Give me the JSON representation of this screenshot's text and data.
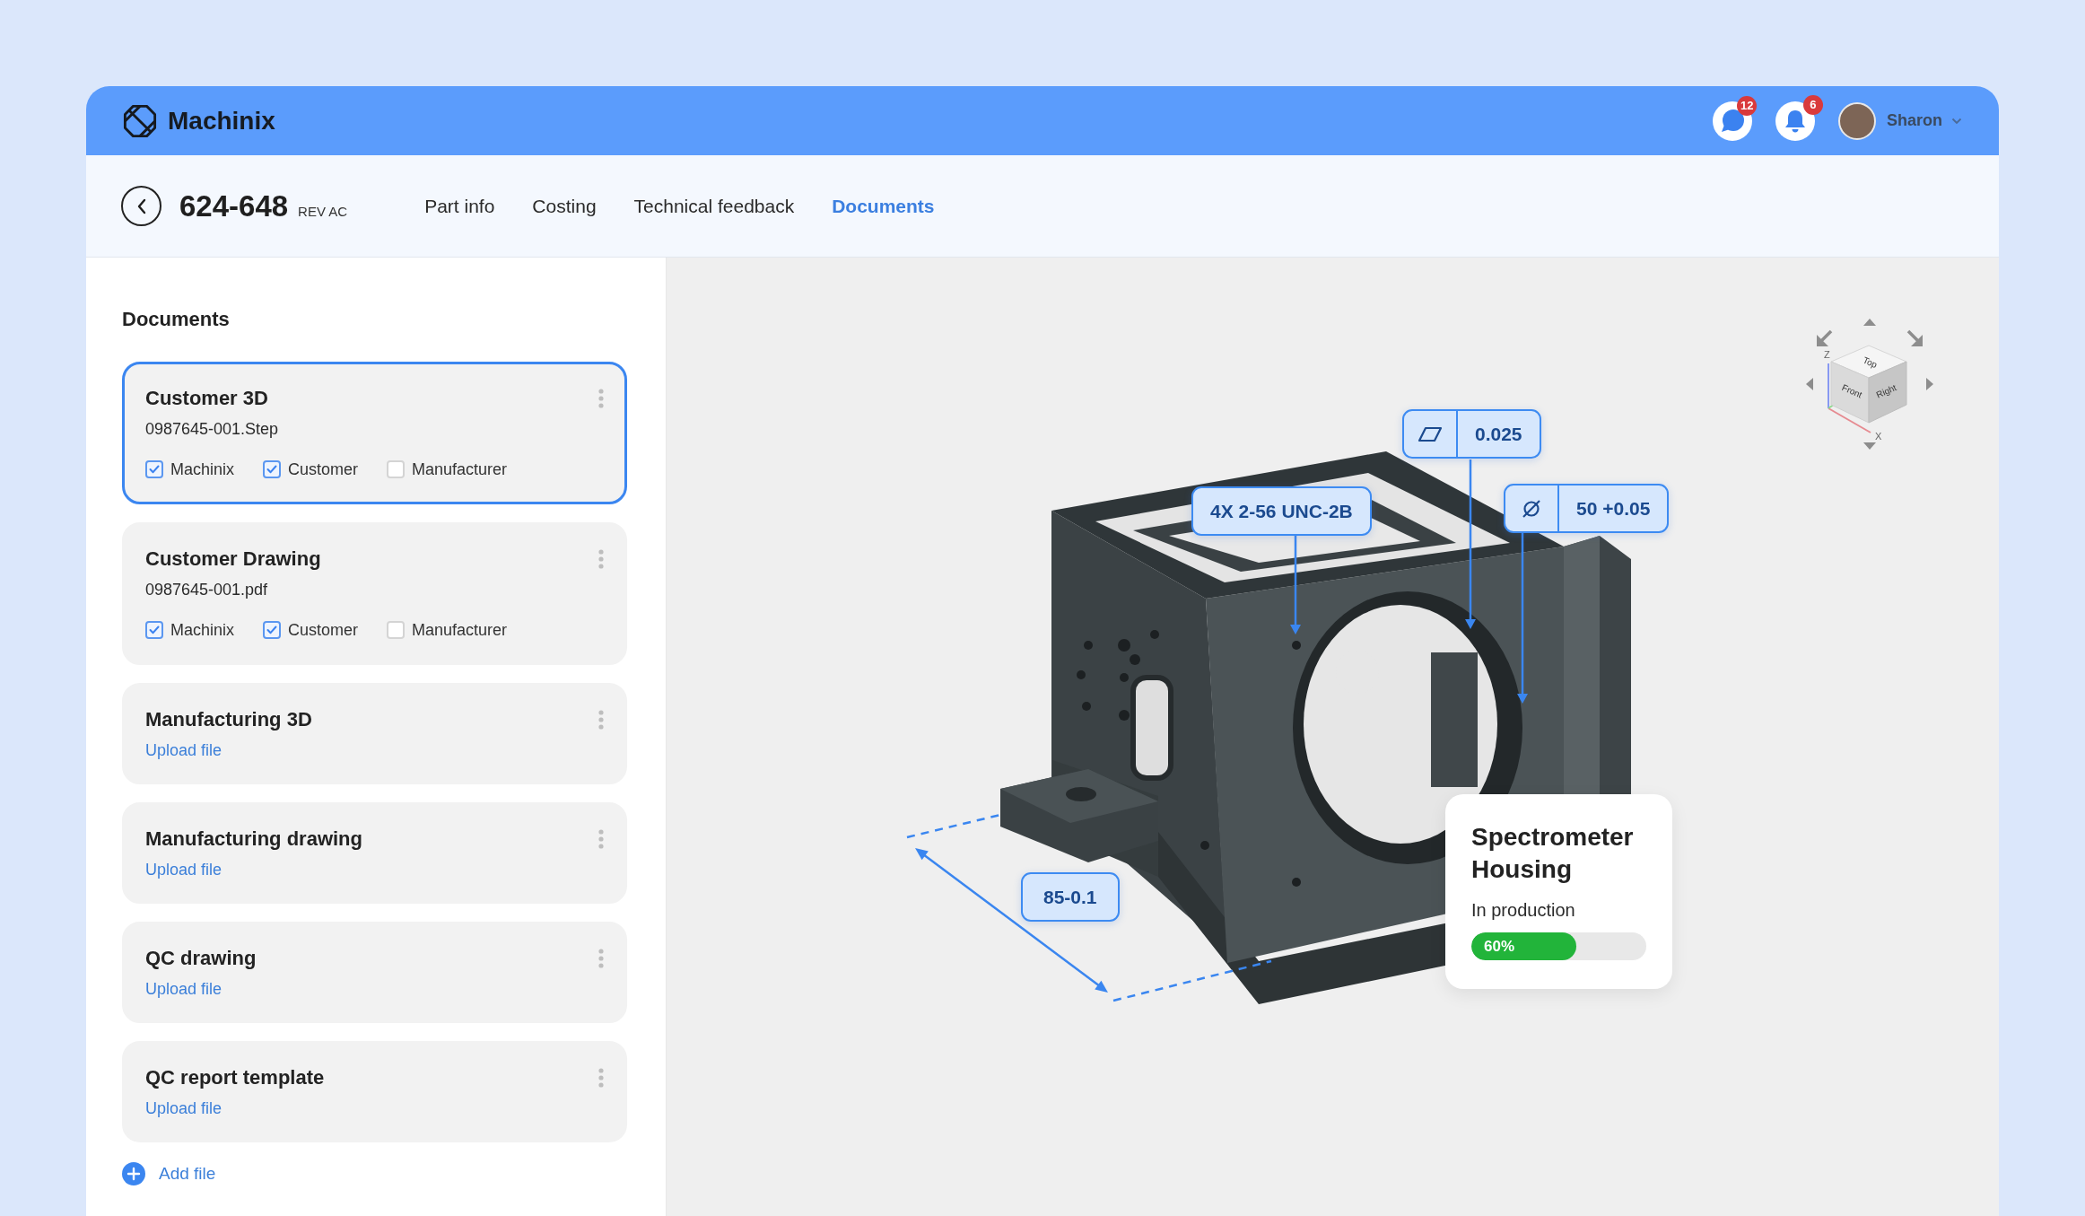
{
  "app": {
    "name": "Machinix"
  },
  "header": {
    "notifications": [
      {
        "kind": "chat",
        "count": "12"
      },
      {
        "kind": "bell",
        "count": "6"
      }
    ],
    "user": {
      "name": "Sharon"
    }
  },
  "part": {
    "number": "624-648",
    "revision": "REV AC"
  },
  "tabs": [
    {
      "label": "Part info",
      "selected": false
    },
    {
      "label": "Costing",
      "selected": false
    },
    {
      "label": "Technical feedback",
      "selected": false
    },
    {
      "label": "Documents",
      "selected": true
    }
  ],
  "documents": {
    "title": "Documents",
    "items": [
      {
        "kind": "file",
        "title": "Customer 3D",
        "selected": true,
        "file": "0987645-001.Step",
        "access": [
          {
            "label": "Machinix",
            "checked": true
          },
          {
            "label": "Customer",
            "checked": true
          },
          {
            "label": "Manufacturer",
            "checked": false
          }
        ]
      },
      {
        "kind": "file",
        "title": "Customer Drawing",
        "selected": false,
        "file": "0987645-001.pdf",
        "access": [
          {
            "label": "Machinix",
            "checked": true
          },
          {
            "label": "Customer",
            "checked": true
          },
          {
            "label": "Manufacturer",
            "checked": false
          }
        ]
      },
      {
        "kind": "empty",
        "title": "Manufacturing 3D",
        "selected": false,
        "action": "Upload file"
      },
      {
        "kind": "empty",
        "title": "Manufacturing drawing",
        "selected": false,
        "action": "Upload file"
      },
      {
        "kind": "empty",
        "title": "QC drawing",
        "selected": false,
        "action": "Upload file"
      },
      {
        "kind": "empty",
        "title": "QC report template",
        "selected": false,
        "action": "Upload file"
      }
    ],
    "add_action": "Add file"
  },
  "viewer": {
    "view_cube": {
      "faces": [
        {
          "label": "Top"
        },
        {
          "label": "Front"
        },
        {
          "label": "Right"
        }
      ],
      "axes": [
        {
          "label": "Z"
        },
        {
          "label": "X"
        }
      ]
    },
    "callouts": [
      {
        "kind": "flatness",
        "text": "0.025"
      },
      {
        "kind": "thread",
        "text": "4X 2-56 UNC-2B"
      },
      {
        "kind": "diameter",
        "text": "50 +0.05"
      },
      {
        "kind": "dimension",
        "text": "85-0.1"
      }
    ],
    "part_card": {
      "name": "Spectrometer Housing",
      "status": "In production",
      "level": 0.6,
      "progress_label": "60%"
    }
  }
}
